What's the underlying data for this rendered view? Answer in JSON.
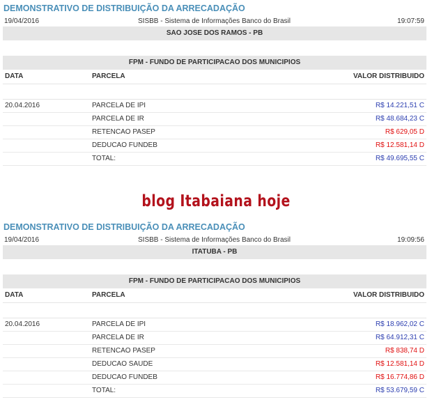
{
  "reports": [
    {
      "title": "DEMONSTRATIVO DE DISTRIBUIÇÃO DA ARRECADAÇÃO",
      "date": "19/04/2016",
      "system": "SISBB - Sistema de Informações Banco do Brasil",
      "time": "19:07:59",
      "municipality": "SAO JOSE DOS RAMOS - PB",
      "fund": "FPM - FUNDO DE PARTICIPACAO DOS MUNICIPIOS",
      "columns": {
        "date": "DATA",
        "parcel": "PARCELA",
        "value": "VALOR DISTRIBUIDO"
      },
      "rows": [
        {
          "date": "20.04.2016",
          "parcel": "PARCELA DE IPI",
          "value": "R$ 14.221,51 C",
          "type": "credit"
        },
        {
          "date": "",
          "parcel": "PARCELA DE IR",
          "value": "R$ 48.684,23 C",
          "type": "credit"
        },
        {
          "date": "",
          "parcel": "RETENCAO PASEP",
          "value": "R$ 629,05 D",
          "type": "debit"
        },
        {
          "date": "",
          "parcel": "DEDUCAO FUNDEB",
          "value": "R$ 12.581,14 D",
          "type": "debit"
        },
        {
          "date": "",
          "parcel": "TOTAL:",
          "value": "R$ 49.695,55 C",
          "type": "credit"
        }
      ]
    },
    {
      "title": "DEMONSTRATIVO DE DISTRIBUIÇÃO DA ARRECADAÇÃO",
      "date": "19/04/2016",
      "system": "SISBB - Sistema de Informações Banco do Brasil",
      "time": "19:09:56",
      "municipality": "ITATUBA - PB",
      "fund": "FPM - FUNDO DE PARTICIPACAO DOS MUNICIPIOS",
      "columns": {
        "date": "DATA",
        "parcel": "PARCELA",
        "value": "VALOR DISTRIBUIDO"
      },
      "rows": [
        {
          "date": "20.04.2016",
          "parcel": "PARCELA DE IPI",
          "value": "R$ 18.962,02 C",
          "type": "credit"
        },
        {
          "date": "",
          "parcel": "PARCELA DE IR",
          "value": "R$ 64.912,31 C",
          "type": "credit"
        },
        {
          "date": "",
          "parcel": "RETENCAO PASEP",
          "value": "R$ 838,74 D",
          "type": "debit"
        },
        {
          "date": "",
          "parcel": "DEDUCAO SAUDE",
          "value": "R$ 12.581,14 D",
          "type": "debit"
        },
        {
          "date": "",
          "parcel": "DEDUCAO FUNDEB",
          "value": "R$ 16.774,86 D",
          "type": "debit"
        },
        {
          "date": "",
          "parcel": "TOTAL:",
          "value": "R$ 53.679,59 C",
          "type": "credit"
        }
      ]
    }
  ],
  "watermark": "blog Itabaiana hoje",
  "colors": {
    "title": "#4a8fb8",
    "credit": "#2d3fb0",
    "debit": "#e01010",
    "watermark": "#b3121c",
    "bar": "#e6e6e6"
  }
}
